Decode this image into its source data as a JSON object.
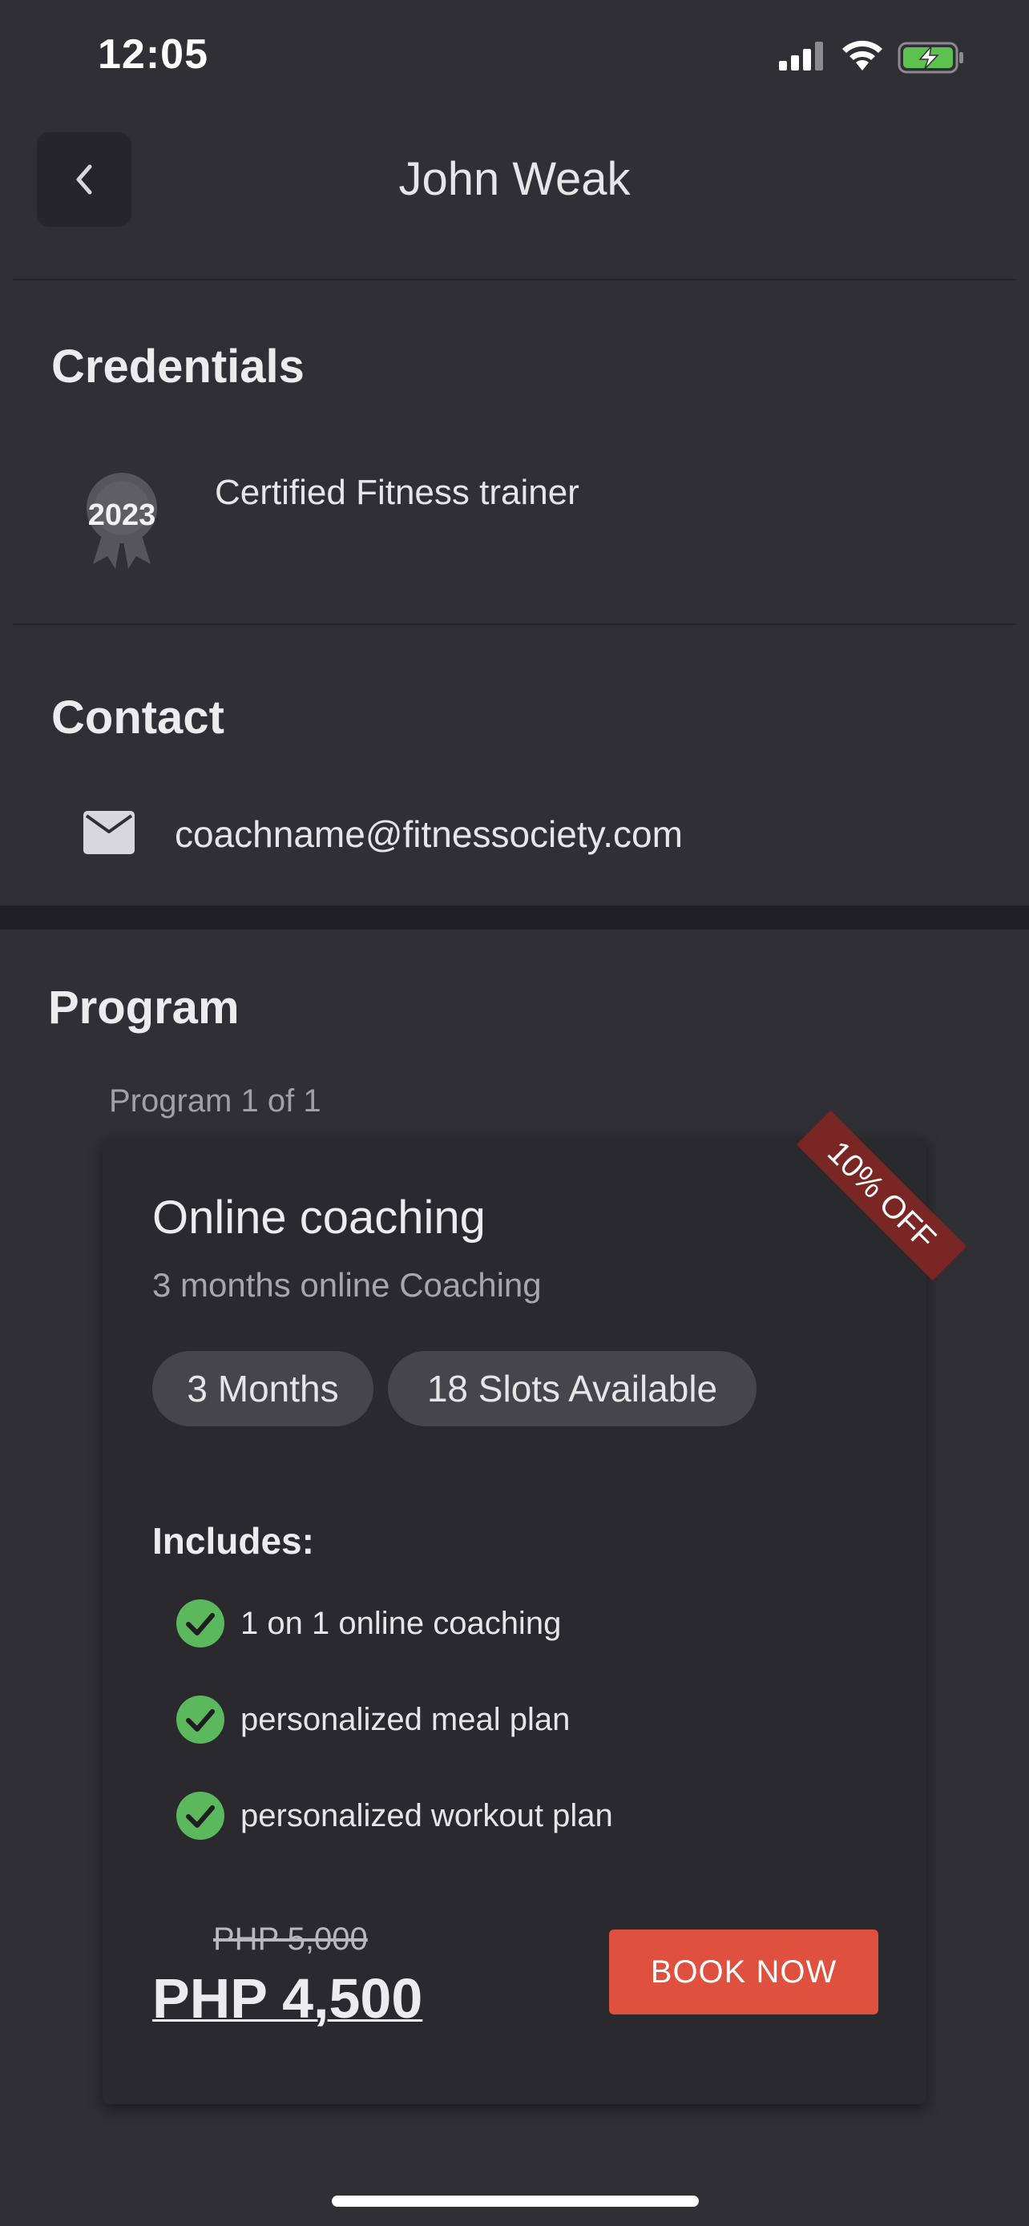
{
  "status_bar": {
    "time": "12:05"
  },
  "header": {
    "title": "John Weak"
  },
  "credentials": {
    "section_title": "Credentials",
    "badge_year": "2023",
    "item_text": "Certified Fitness trainer"
  },
  "contact": {
    "section_title": "Contact",
    "email": "coachname@fitnessociety.com"
  },
  "program": {
    "section_title": "Program",
    "counter": "Program 1 of 1",
    "card": {
      "ribbon": "10% OFF",
      "title": "Online coaching",
      "subtitle": "3 months online Coaching",
      "chips": [
        "3 Months",
        "18 Slots Available"
      ],
      "includes_title": "Includes:",
      "includes": [
        "1 on 1 online coaching",
        "personalized meal plan",
        "personalized workout plan"
      ],
      "old_price": "PHP 5,000",
      "price": "PHP 4,500",
      "book_label": "BOOK NOW"
    }
  },
  "colors": {
    "background": "#2f2f35",
    "card": "#29292e",
    "accent_button": "#e0503f",
    "ribbon": "#7a2625",
    "check": "#5cb85c"
  }
}
